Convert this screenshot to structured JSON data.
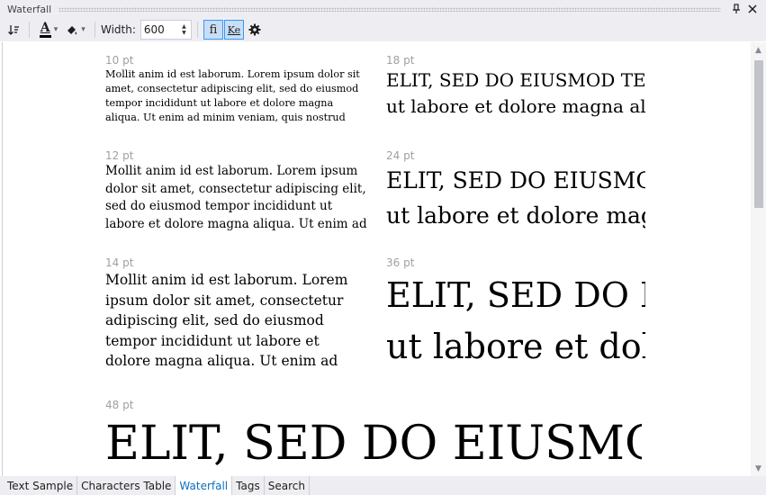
{
  "panel": {
    "title": "Waterfall",
    "pin_glyph": "📌",
    "close_glyph": "✕"
  },
  "toolbar": {
    "sort_icon": "sort-icon",
    "text_color_glyph": "A",
    "fill_glyph": "◕",
    "dropdown_glyph": "▾",
    "width_label": "Width:",
    "width_value": "600",
    "ligature_label": "fi",
    "kerning_label": "Ke",
    "settings_icon": "gear-icon"
  },
  "waterfall": {
    "cells": [
      {
        "size": "10 pt",
        "text": "Mollit anim id est laborum. Lorem ipsum dolor sit amet, consectetur adipiscing elit, sed do eiusmod tempor incididunt ut labore et dolore magna aliqua. Ut enim ad minim veniam, quis nostrud"
      },
      {
        "size": "18 pt",
        "line1": "ELIT, SED DO EIUSMOD TEMPOR",
        "line2": "ut labore et dolore magna aliqua"
      },
      {
        "size": "12 pt",
        "text": "Mollit anim id est laborum. Lorem ipsum dolor sit amet, consectetur adipiscing elit, sed do eiusmod tempor incididunt ut labore et dolore magna aliqua. Ut enim ad"
      },
      {
        "size": "24 pt",
        "line1": "ELIT, SED DO EIUSMOD",
        "line2": "ut labore et dolore magna"
      },
      {
        "size": "14 pt",
        "text": "Mollit anim id est laborum. Lorem ipsum dolor sit amet, consectetur adipiscing elit, sed do eiusmod tempor incididunt ut labore et dolore magna aliqua. Ut enim ad"
      },
      {
        "size": "36 pt",
        "line1": "ELIT, SED DO EIUSMOD",
        "line2": "ut labore et dolore"
      },
      {
        "size": "48 pt",
        "line1": "ELIT, SED DO EIUSMOD"
      }
    ]
  },
  "tabs": [
    {
      "label": "Text Sample"
    },
    {
      "label": "Characters Table"
    },
    {
      "label": "Waterfall",
      "active": true
    },
    {
      "label": "Tags"
    },
    {
      "label": "Search"
    }
  ],
  "colors": {
    "accent": "#0e70c0",
    "chrome": "#eeeef2",
    "size_label": "#a0a0a0"
  }
}
